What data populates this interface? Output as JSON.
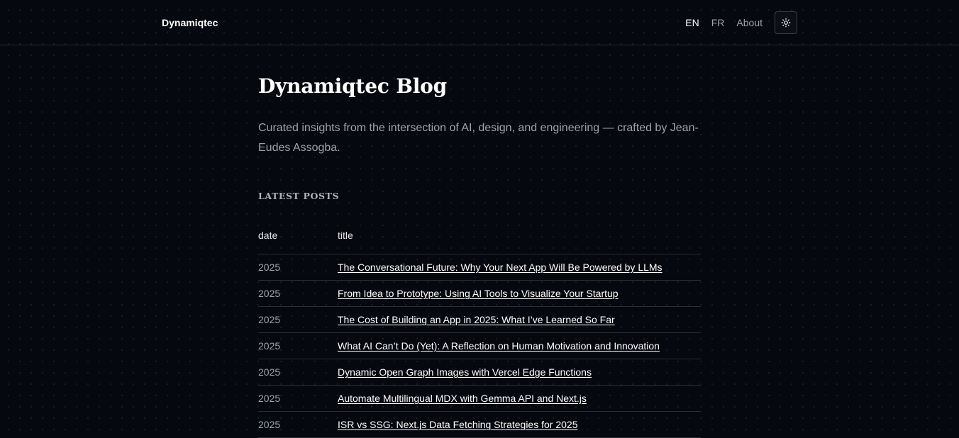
{
  "header": {
    "brand": "Dynamiqtec",
    "nav": {
      "en": "EN",
      "fr": "FR",
      "about": "About"
    },
    "theme_toggle_icon": "sun-icon"
  },
  "main": {
    "title": "Dynamiqtec Blog",
    "intro": "Curated insights from the intersection of AI, design, and engineering — crafted by Jean-Eudes Assogba.",
    "section_heading": "Latest Posts",
    "table": {
      "columns": [
        "date",
        "title"
      ],
      "rows": [
        {
          "date": "2025",
          "title": "The Conversational Future: Why Your Next App Will Be Powered by LLMs"
        },
        {
          "date": "2025",
          "title": "From Idea to Prototype: Using AI Tools to Visualize Your Startup"
        },
        {
          "date": "2025",
          "title": "The Cost of Building an App in 2025: What I’ve Learned So Far"
        },
        {
          "date": "2025",
          "title": "What AI Can’t Do (Yet): A Reflection on Human Motivation and Innovation"
        },
        {
          "date": "2025",
          "title": "Dynamic Open Graph Images with Vercel Edge Functions"
        },
        {
          "date": "2025",
          "title": "Automate Multilingual MDX with Gemma API and Next.js"
        },
        {
          "date": "2025",
          "title": "ISR vs SSG: Next.js Data Fetching Strategies for 2025"
        }
      ]
    }
  },
  "colors": {
    "background": "#06080f",
    "text_primary": "#ffffff",
    "text_muted": "#9ca3af",
    "border": "#2a2e37"
  }
}
